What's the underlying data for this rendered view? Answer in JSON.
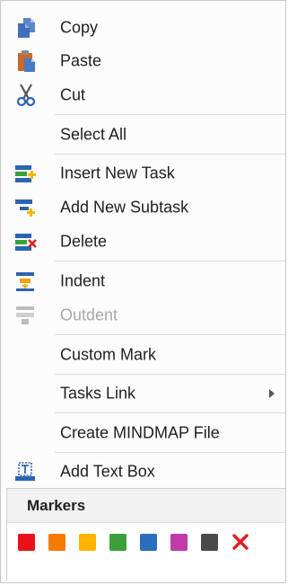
{
  "menu": {
    "items": [
      {
        "label": "Copy",
        "icon": "copy-icon",
        "disabled": false
      },
      {
        "label": "Paste",
        "icon": "paste-icon",
        "disabled": false
      },
      {
        "label": "Cut",
        "icon": "cut-icon",
        "disabled": false
      },
      {
        "label": "Select All",
        "icon": "",
        "disabled": false
      },
      {
        "label": "Insert New Task",
        "icon": "insert-task-icon",
        "disabled": false
      },
      {
        "label": "Add New Subtask",
        "icon": "add-subtask-icon",
        "disabled": false
      },
      {
        "label": "Delete",
        "icon": "delete-task-icon",
        "disabled": false
      },
      {
        "label": "Indent",
        "icon": "indent-icon",
        "disabled": false
      },
      {
        "label": "Outdent",
        "icon": "outdent-icon",
        "disabled": true
      },
      {
        "label": "Custom Mark",
        "icon": "",
        "disabled": false
      },
      {
        "label": "Tasks Link",
        "icon": "",
        "disabled": false,
        "submenu": true
      },
      {
        "label": "Create MINDMAP File",
        "icon": "",
        "disabled": false
      },
      {
        "label": "Add Text Box",
        "icon": "text-box-icon",
        "disabled": false
      }
    ]
  },
  "markers": {
    "title": "Markers",
    "colors": [
      "#e8121b",
      "#f57c00",
      "#ffb300",
      "#3aa03a",
      "#2a6ebb",
      "#c03aa8",
      "#4a4a4a"
    ],
    "clear_icon": "red-x-icon",
    "clear_color": "#e02020"
  }
}
